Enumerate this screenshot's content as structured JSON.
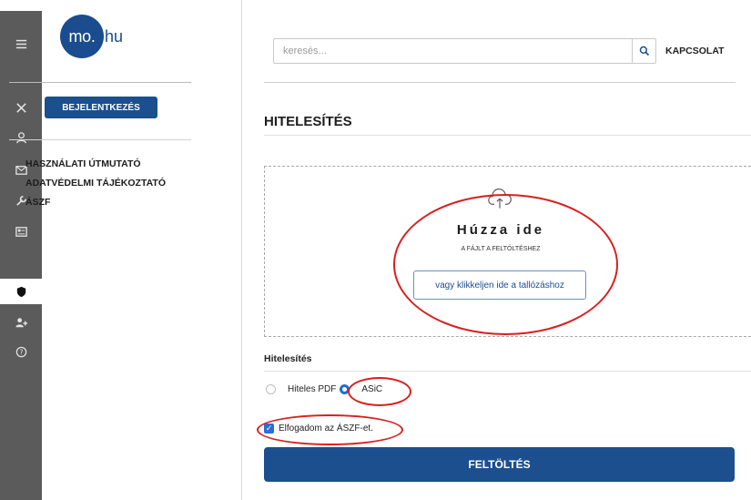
{
  "brand": {
    "logo_circle": "mo.",
    "logo_rest": "hu"
  },
  "rail": {
    "icons": [
      "menu-icon",
      "tools-icon",
      "user-icon",
      "mail-icon",
      "wrench-icon",
      "id-card-icon",
      "shield-icon",
      "add-user-icon",
      "help-icon"
    ],
    "active": "shield-icon"
  },
  "sidebar": {
    "login_label": "BEJELENTKEZÉS",
    "links": [
      "HASZNÁLATI ÚTMUTATÓ",
      "ADATVÉDELMI TÁJÉKOZTATÓ",
      "ÁSZF"
    ]
  },
  "header": {
    "search_placeholder": "keresés...",
    "contact_label": "KAPCSOLAT"
  },
  "main": {
    "title": "HITELESÍTÉS",
    "dropzone": {
      "title": "Húzza ide",
      "subtitle": "A FÁJLT A FELTÖLTÉSHEZ",
      "browse_label": "vagy klikkeljen ide a tallózáshoz"
    },
    "section_label": "Hitelesítés",
    "options": [
      {
        "label": "Hiteles PDF",
        "checked": false
      },
      {
        "label": "ASiC",
        "checked": true
      }
    ],
    "accept_label": "Elfogadom az ÁSZF-et.",
    "accept_checked": true,
    "upload_label": "FELTÖLTÉS"
  },
  "colors": {
    "brand_blue": "#1b4f8e",
    "radio_blue": "#1e6fd0",
    "annotation_red": "#d8201f",
    "rail_gray": "#5b5b5b"
  }
}
